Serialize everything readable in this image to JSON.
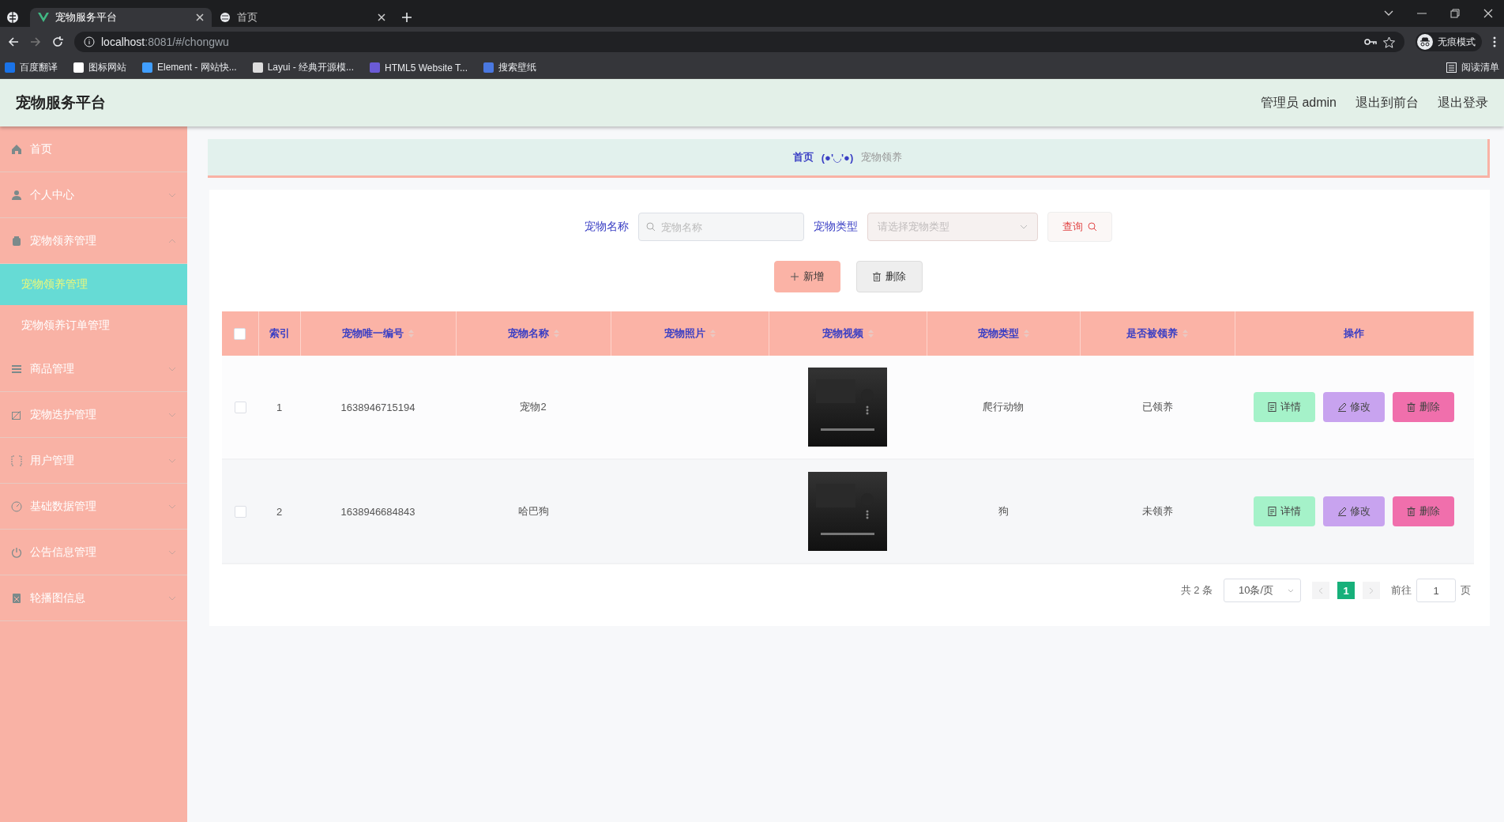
{
  "browser": {
    "tabs": [
      {
        "title": "宠物服务平台",
        "selected": true
      },
      {
        "title": "首页",
        "selected": false
      }
    ],
    "address": {
      "host": "localhost",
      "rest": ":8081/#/chongwu"
    },
    "profile": "无痕模式",
    "bookmarks": [
      "百度翻译",
      "图标网站",
      "Element - 网站快...",
      "Layui - 经典开源模...",
      "HTML5 Website T...",
      "搜索壁纸"
    ],
    "reading_list": "阅读清单"
  },
  "header": {
    "title": "宠物服务平台",
    "links": [
      "管理员 admin",
      "退出到前台",
      "退出登录"
    ]
  },
  "sidebar": {
    "items": [
      {
        "label": "首页"
      },
      {
        "label": "个人中心",
        "expanded": false
      },
      {
        "label": "宠物领养管理",
        "expanded": true,
        "children": [
          {
            "label": "宠物领养管理",
            "selected": true
          },
          {
            "label": "宠物领养订单管理",
            "selected": false
          }
        ]
      },
      {
        "label": "商品管理",
        "expanded": false
      },
      {
        "label": "宠物迭护管理",
        "expanded": false
      },
      {
        "label": "用户管理",
        "expanded": false
      },
      {
        "label": "基础数据管理",
        "expanded": false
      },
      {
        "label": "公告信息管理",
        "expanded": false
      },
      {
        "label": "轮播图信息",
        "expanded": false
      }
    ]
  },
  "breadcrumb": {
    "home": "首页",
    "separator": "(●'◡'●)",
    "current": "宠物领养"
  },
  "search": {
    "fields": [
      {
        "label": "宠物名称",
        "kind": "input",
        "placeholder": "宠物名称"
      },
      {
        "label": "宠物类型",
        "kind": "select",
        "placeholder": "请选择宠物类型"
      }
    ],
    "button": "查询"
  },
  "actions": [
    {
      "label": "新增",
      "kind": "add"
    },
    {
      "label": "删除",
      "kind": "delete"
    }
  ],
  "table": {
    "select_all": {
      "checked": false
    },
    "columns": [
      {
        "label": "索引",
        "sortable": false
      },
      {
        "label": "宠物唯一编号",
        "sortable": true
      },
      {
        "label": "宠物名称",
        "sortable": true
      },
      {
        "label": "宠物照片",
        "sortable": true
      },
      {
        "label": "宠物视频",
        "sortable": true
      },
      {
        "label": "宠物类型",
        "sortable": true
      },
      {
        "label": "是否被领养",
        "sortable": true
      },
      {
        "label": "操作",
        "sortable": false
      }
    ],
    "rows": [
      {
        "checked": false,
        "index": "1",
        "id": "1638946715194",
        "name": "宠物2",
        "type": "爬行动物",
        "adopted": "已领养",
        "buttons": [
          "详情",
          "修改",
          "删除"
        ]
      },
      {
        "checked": false,
        "index": "2",
        "id": "1638946684843",
        "name": "哈巴狗",
        "type": "狗",
        "adopted": "未领养",
        "buttons": [
          "详情",
          "修改",
          "删除"
        ]
      }
    ]
  },
  "pagination": {
    "total": "共 2 条",
    "page_size": "10条/页",
    "pages": [
      {
        "label": "1",
        "selected": true
      }
    ],
    "goto_label": "前往",
    "goto_value": "1",
    "page_unit": "页"
  }
}
